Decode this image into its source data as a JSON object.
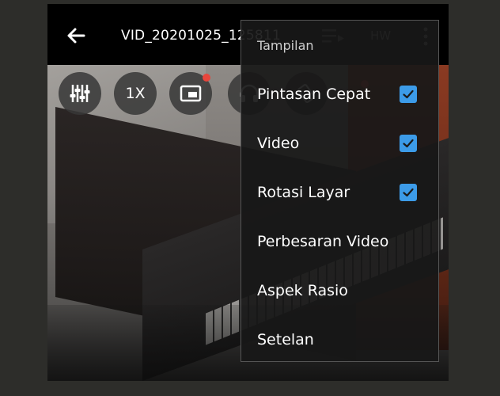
{
  "header": {
    "title": "VID_20201025_125811",
    "hw_label": "HW"
  },
  "icons": {
    "back": "arrow-left-icon",
    "playlist": "playlist-icon",
    "more": "more-vert-icon",
    "equalizer": "equalizer-icon",
    "popup": "picture-in-picture-icon",
    "headphones": "headphones-icon",
    "rotate": "screen-rotation-icon",
    "check": "check-icon"
  },
  "controls": {
    "speed_label": "1X"
  },
  "menu": {
    "header": "Tampilan",
    "items": [
      {
        "label": "Pintasan Cepat",
        "checked": true
      },
      {
        "label": "Video",
        "checked": true
      },
      {
        "label": "Rotasi Layar",
        "checked": true
      },
      {
        "label": "Perbesaran Video",
        "checked": false
      },
      {
        "label": "Aspek Rasio",
        "checked": false
      },
      {
        "label": "Setelan",
        "checked": false
      }
    ]
  },
  "colors": {
    "accent": "#3c9be8",
    "badge": "#e8453c",
    "menu_bg": "#181818"
  }
}
